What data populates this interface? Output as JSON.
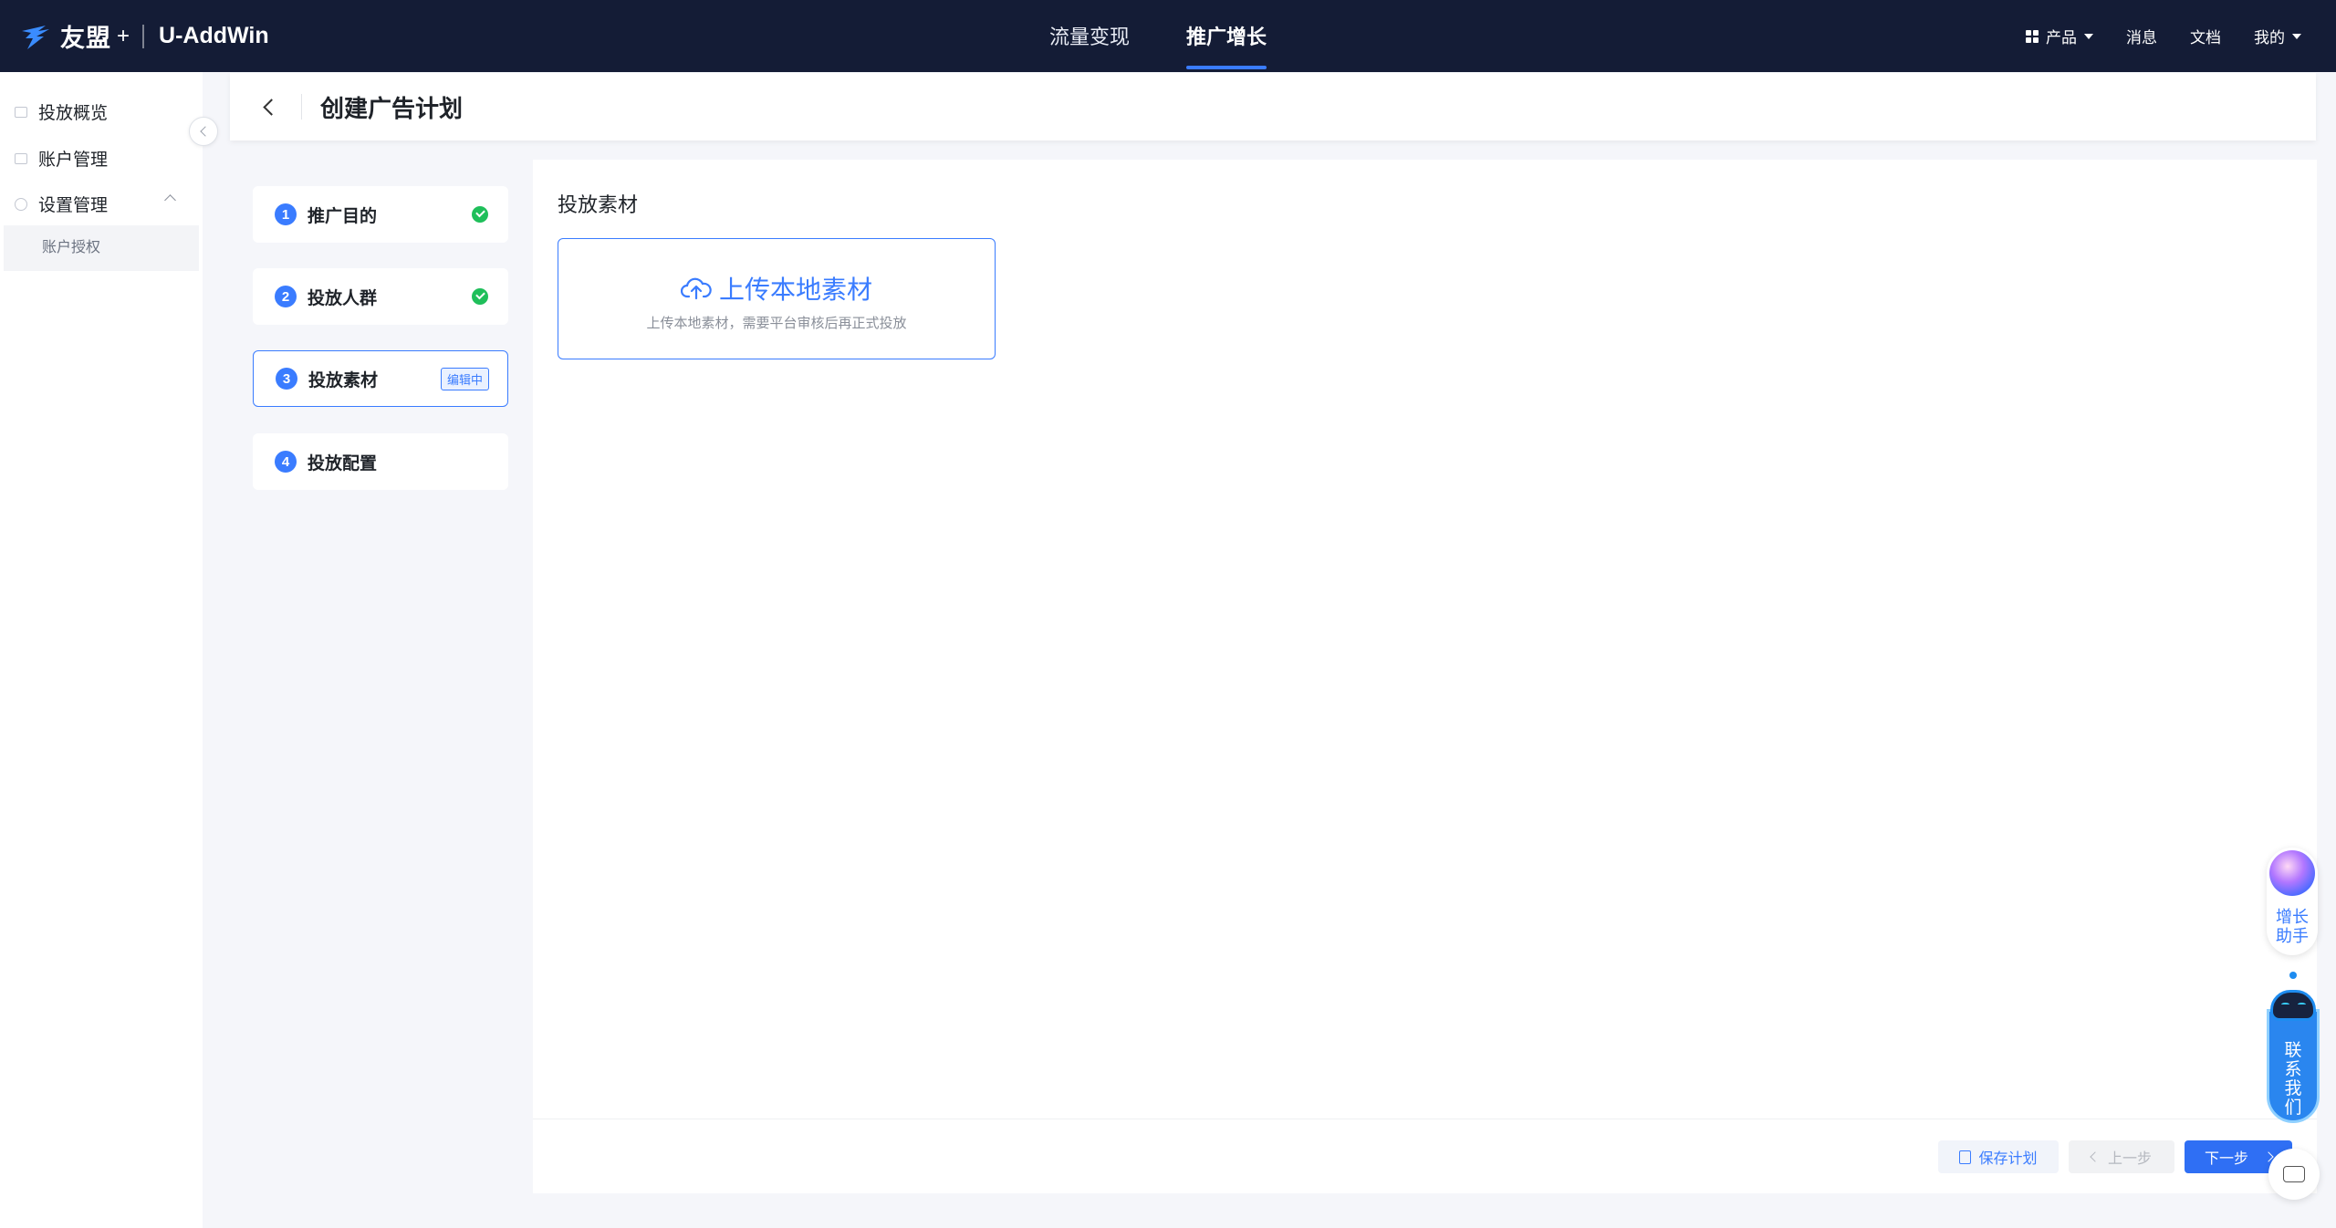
{
  "topbar": {
    "brand_name": "友盟",
    "brand_plus": "+",
    "product_name": "U-AddWin",
    "nav": [
      {
        "label": "流量变现",
        "active": false
      },
      {
        "label": "推广增长",
        "active": true
      }
    ],
    "right": {
      "products_label": "产品",
      "messages_label": "消息",
      "docs_label": "文档",
      "mine_label": "我的"
    }
  },
  "sidebar": {
    "items": [
      {
        "label": "投放概览",
        "icon": "list-icon"
      },
      {
        "label": "账户管理",
        "icon": "account-icon"
      },
      {
        "label": "设置管理",
        "icon": "gear-icon",
        "expanded": true
      }
    ],
    "sub_items": [
      {
        "label": "账户授权"
      }
    ]
  },
  "page": {
    "title": "创建广告计划"
  },
  "steps": [
    {
      "num": "1",
      "label": "推广目的",
      "status": "done"
    },
    {
      "num": "2",
      "label": "投放人群",
      "status": "done"
    },
    {
      "num": "3",
      "label": "投放素材",
      "status": "editing",
      "badge": "编辑中"
    },
    {
      "num": "4",
      "label": "投放配置",
      "status": "pending"
    }
  ],
  "content": {
    "section_title": "投放素材",
    "upload_title": "上传本地素材",
    "upload_hint": "上传本地素材，需要平台审核后再正式投放"
  },
  "footer": {
    "save_label": "保存计划",
    "prev_label": "上一步",
    "next_label": "下一步"
  },
  "floating": {
    "grow_label_line1": "增长",
    "grow_label_line2": "助手",
    "contact_label": [
      "联",
      "系",
      "我",
      "们"
    ]
  },
  "colors": {
    "topbar_bg": "#141c36",
    "accent": "#3a7cff",
    "success": "#1fbf5a"
  }
}
